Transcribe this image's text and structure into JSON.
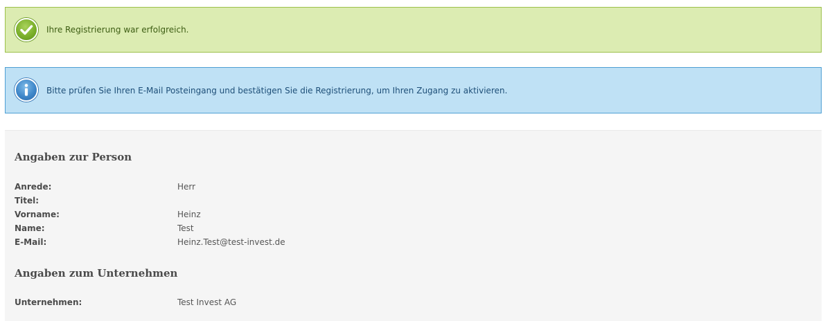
{
  "success_alert": {
    "icon": "checkmark-circle-icon",
    "text": "Ihre Registrierung war erfolgreich.",
    "colors": {
      "background": "#dcecb2",
      "border": "#9cc04a"
    }
  },
  "info_alert": {
    "icon": "info-circle-icon",
    "text": "Bitte prüfen Sie Ihren E-Mail Posteingang und bestätigen Sie die Registrierung, um Ihren Zugang zu aktivieren.",
    "colors": {
      "background": "#bfe1f5",
      "border": "#4e9fd3"
    }
  },
  "person": {
    "title": "Angaben zur Person",
    "fields": [
      {
        "label": "Anrede:",
        "value": "Herr"
      },
      {
        "label": "Titel:",
        "value": ""
      },
      {
        "label": "Vorname:",
        "value": "Heinz"
      },
      {
        "label": "Name:",
        "value": "Test"
      },
      {
        "label": "E-Mail:",
        "value": "Heinz.Test@test-invest.de"
      }
    ]
  },
  "company": {
    "title": "Angaben zum Unternehmen",
    "fields": [
      {
        "label": "Unternehmen:",
        "value": "Test Invest AG"
      }
    ]
  }
}
